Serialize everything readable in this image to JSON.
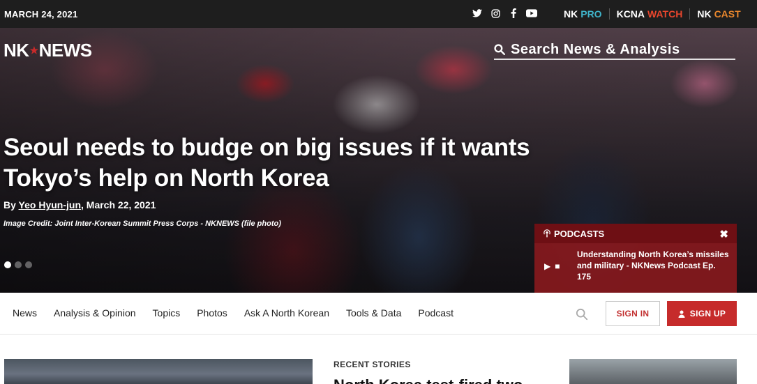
{
  "topbar": {
    "date": "MARCH 24, 2021",
    "social": [
      "twitter-icon",
      "instagram-icon",
      "facebook-icon",
      "youtube-icon"
    ],
    "brands": [
      {
        "first": "NK",
        "second": "PRO",
        "color": "#3fb3c9"
      },
      {
        "first": "KCNA",
        "second": "WATCH",
        "color": "#e8462d"
      },
      {
        "first": "NK",
        "second": "CAST",
        "color": "#e8862d"
      }
    ]
  },
  "header": {
    "logo_left": "NK",
    "logo_right": "NEWS",
    "search_placeholder": "Search News & Analysis"
  },
  "hero": {
    "headline": "Seoul needs to budge on big issues if it wants Tokyo’s help on North Korea",
    "byline_prefix": "By ",
    "author": "Yeo Hyun-jun",
    "date": ", March 22, 2021",
    "credit": "Image Credit: Joint Inter-Korean Summit Press Corps - NKNEWS (file photo)",
    "slides": 3,
    "active_slide": 1
  },
  "podcast": {
    "label": "PODCASTS",
    "close": "✖",
    "title": "Understanding North Korea’s missiles and military - NKNews Podcast Ep. 175"
  },
  "nav": {
    "items": [
      "News",
      "Analysis & Opinion",
      "Topics",
      "Photos",
      "Ask A North Korean",
      "Tools & Data",
      "Podcast"
    ],
    "sign_in": "SIGN IN",
    "sign_up": "SIGN UP"
  },
  "content": {
    "recent_label": "RECENT STORIES",
    "recent_title": "North Korea test-fired two"
  },
  "colors": {
    "topbar_bg": "#1e1e1e",
    "accent_red": "#c62b2b",
    "podcast_bg": "#8c191e"
  }
}
